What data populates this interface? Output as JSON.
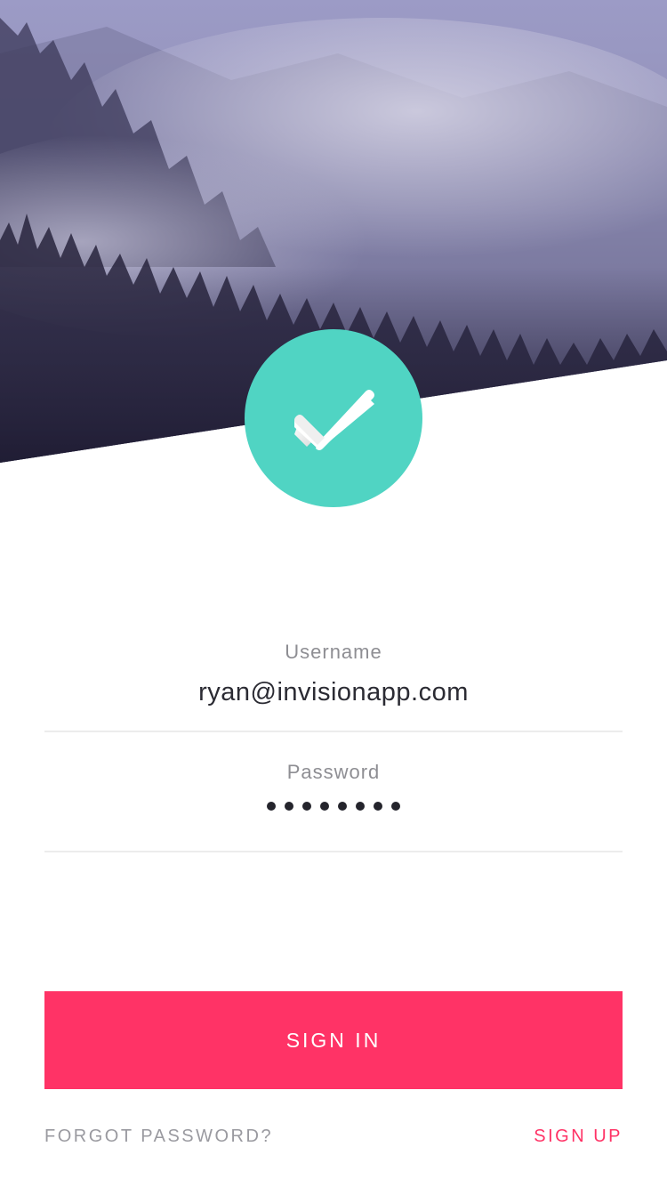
{
  "hero": {
    "image": "misty-forest-photo"
  },
  "logo": {
    "icon": "checkmark-icon",
    "color": "#50d4c3"
  },
  "form": {
    "username": {
      "label": "Username",
      "value": "ryan@invisionapp.com"
    },
    "password": {
      "label": "Password",
      "masked_length": 8
    }
  },
  "actions": {
    "sign_in_label": "SIGN IN",
    "forgot_password_label": "FORGOT PASSWORD?",
    "sign_up_label": "SIGN UP"
  },
  "colors": {
    "accent": "#ff3366",
    "teal": "#50d4c3",
    "label_gray": "#8e8e93",
    "text_dark": "#2b2b33"
  }
}
